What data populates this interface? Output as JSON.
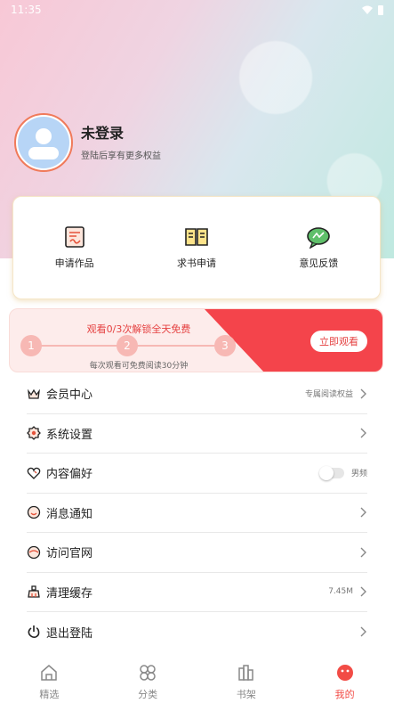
{
  "status_bar": {
    "time": "11:35"
  },
  "profile": {
    "name": "未登录",
    "subtitle": "登陆后享有更多权益"
  },
  "quick_actions": [
    {
      "label": "申请作品",
      "icon": "apply-works-icon"
    },
    {
      "label": "求书申请",
      "icon": "book-request-icon"
    },
    {
      "label": "意见反馈",
      "icon": "feedback-icon"
    }
  ],
  "promo": {
    "title": "观看0/3次解锁全天免费",
    "steps": [
      "1",
      "2",
      "3"
    ],
    "progress_watched": 0,
    "progress_total": 3,
    "note": "每次观看可免费阅读30分钟",
    "button": "立即观看"
  },
  "menu": [
    {
      "label": "会员中心",
      "icon": "crown-icon",
      "value": "专属阅读权益"
    },
    {
      "label": "系统设置",
      "icon": "gear-icon",
      "value": ""
    },
    {
      "label": "内容偏好",
      "icon": "heart-icon",
      "value": "男频",
      "toggle": false
    },
    {
      "label": "消息通知",
      "icon": "message-icon",
      "value": ""
    },
    {
      "label": "访问官网",
      "icon": "website-icon",
      "value": ""
    },
    {
      "label": "清理缓存",
      "icon": "broom-icon",
      "value": "7.45M"
    },
    {
      "label": "退出登陆",
      "icon": "power-icon",
      "value": ""
    }
  ],
  "tabs": [
    {
      "label": "精选",
      "icon": "home-icon",
      "active": false
    },
    {
      "label": "分类",
      "icon": "category-icon",
      "active": false
    },
    {
      "label": "书架",
      "icon": "bookshelf-icon",
      "active": false
    },
    {
      "label": "我的",
      "icon": "mine-icon",
      "active": true
    }
  ],
  "colors": {
    "accent": "#f24c46",
    "avatar_border": "#f07a5a"
  }
}
